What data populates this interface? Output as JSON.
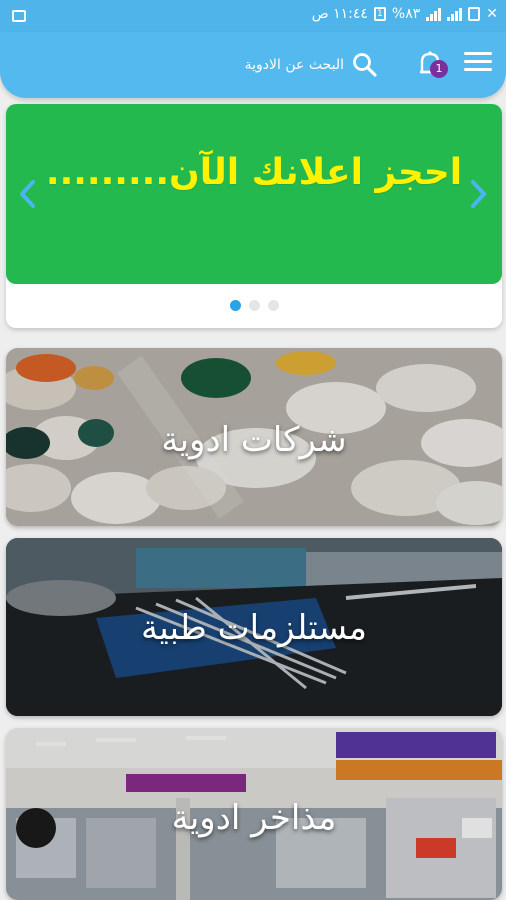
{
  "status_bar": {
    "time": "١١:٤٤ ص",
    "battery": "%٨٣",
    "notification_count": "1"
  },
  "app_bar": {
    "search_label": "البحث عن الادوية",
    "cart_badge": "1"
  },
  "carousel": {
    "banner_text": "احجز اعلانك الآن.........",
    "banner_color": "#23b94f",
    "text_color": "#fff200",
    "slide_count": 3,
    "active_slide": 1
  },
  "categories": [
    {
      "label": "شركات ادوية"
    },
    {
      "label": "مستلزمات طبية"
    },
    {
      "label": "مذاخر ادوية"
    }
  ],
  "colors": {
    "accent": "#53b9ef",
    "badge": "#7b2f9e",
    "dot_active": "#2aa3e6"
  },
  "icons": [
    "menu-icon",
    "cart-icon",
    "search-icon",
    "chevron-left-icon",
    "chevron-right-icon"
  ]
}
